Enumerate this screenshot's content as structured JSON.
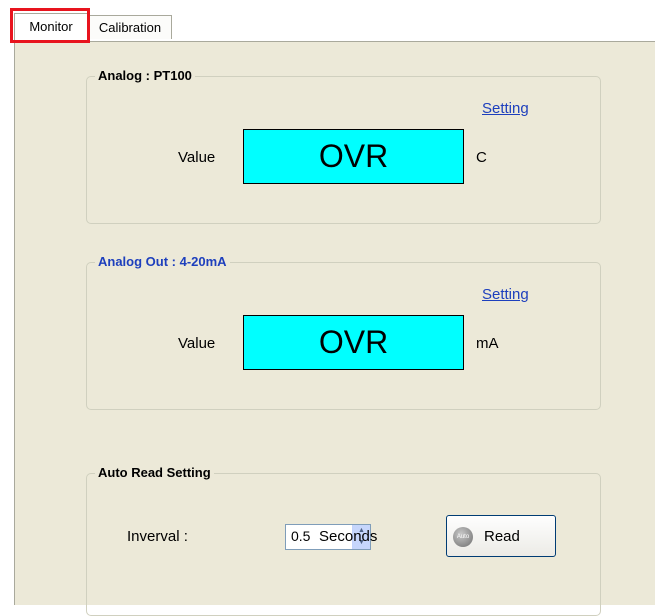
{
  "tabs": [
    {
      "label": "Monitor",
      "selected": true
    },
    {
      "label": "Calibration",
      "selected": false
    }
  ],
  "analog_in": {
    "title": "Analog : PT100",
    "setting_link": "Setting",
    "value_label": "Value",
    "value": "OVR",
    "unit": "C"
  },
  "analog_out": {
    "title": "Analog Out : 4-20mA",
    "setting_link": "Setting",
    "value_label": "Value",
    "value": "OVR",
    "unit": "mA"
  },
  "auto_read": {
    "title": "Auto Read Setting",
    "interval_label": "Inverval :",
    "interval_value": "0.5",
    "interval_unit": "Seconds",
    "read_button": "Read",
    "read_button_icon": "Auto"
  },
  "colors": {
    "value_box": "#00ffff",
    "panel_bg": "#ece9d8",
    "link": "#1d3fbd",
    "analog_out_title": "#1d3fbd",
    "highlight": "#e8141e"
  }
}
